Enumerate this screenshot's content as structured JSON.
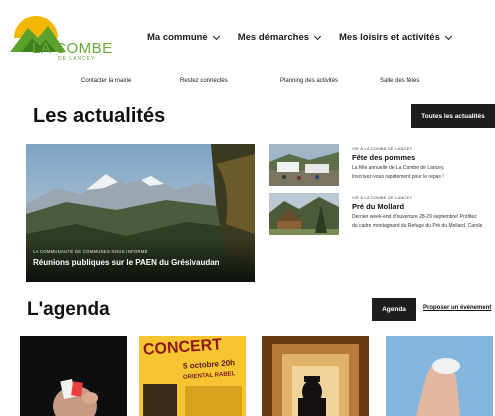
{
  "logo": {
    "name": "LA COMBE",
    "sub": "DE LANCEY",
    "colors": {
      "sun": "#f2b705",
      "mountain": "#5aa12e",
      "text": "#6aa83a"
    }
  },
  "main_nav": [
    {
      "label": "Ma commune",
      "icon": "chevron-down-icon"
    },
    {
      "label": "Mes démarches",
      "icon": "chevron-down-icon"
    },
    {
      "label": "Mes loisirs et activités",
      "icon": "chevron-down-icon"
    }
  ],
  "quick_links": [
    {
      "label": "Contacter la mairie"
    },
    {
      "label": "Restez connectés"
    },
    {
      "label": "Planning des activités"
    },
    {
      "label": "Salle des fêtes"
    }
  ],
  "news": {
    "title": "Les actualités",
    "all_button": "Toutes les actualités",
    "feature": {
      "kicker": "LA COMMUNAUTÉ DE COMMUNES NOUS INFORME",
      "title": "Réunions publiques sur le PAEN du Grésivaudan"
    },
    "items": [
      {
        "category": "VIE À LA COMBE DE LANCEY",
        "title": "Fête des pommes",
        "line1": "La fête annuelle de La Combe de Lancey.",
        "line2": "Inscrivez-vous rapidement pour le repas !"
      },
      {
        "category": "VIE À LA COMBE DE LANCEY",
        "title": "Pré du Mollard",
        "line1": "Dernier week-end d'ouverture 28-29 septembre! Profitez",
        "line2": "du cadre montagnard du Refuge du Pré du Mollard. Carole"
      }
    ]
  },
  "agenda": {
    "title": "L'agenda",
    "agenda_button": "Agenda",
    "propose_link": "Proposer un évènement",
    "cards": [
      {
        "image": "magician-photo"
      },
      {
        "image": "concert-poster",
        "line1": "CONCERT",
        "line2": "5 octobre 20h",
        "line3": "ORIENTAL RABEL"
      },
      {
        "image": "theatre-silhouette-photo"
      },
      {
        "image": "hand-photo"
      }
    ]
  },
  "colors": {
    "accent_dark": "#1e1e1e",
    "poster_yellow": "#f7c531"
  }
}
